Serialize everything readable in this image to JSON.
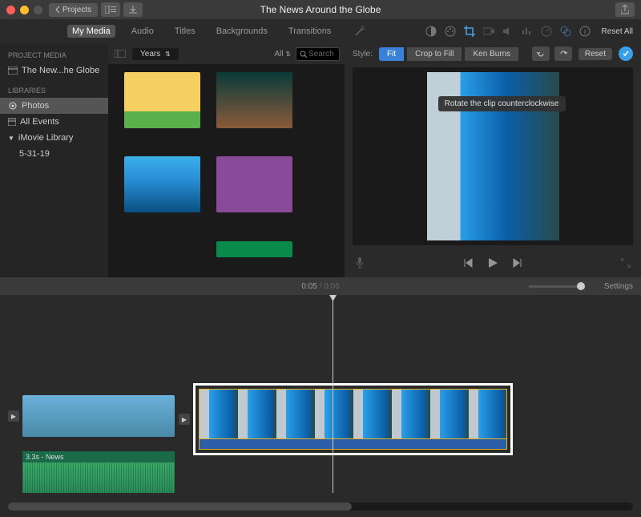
{
  "titlebar": {
    "projects_label": "Projects",
    "title": "The News Around the Globe"
  },
  "tabs": {
    "my_media": "My Media",
    "audio": "Audio",
    "titles": "Titles",
    "backgrounds": "Backgrounds",
    "transitions": "Transitions"
  },
  "sidebar": {
    "project_media_hdr": "PROJECT MEDIA",
    "project_item": "The New...he Globe",
    "libraries_hdr": "LIBRARIES",
    "photos": "Photos",
    "all_events": "All Events",
    "imovie_lib": "iMovie Library",
    "date": "5-31-19"
  },
  "browser": {
    "years": "Years",
    "all": "All",
    "search_placeholder": "Search"
  },
  "viewer": {
    "reset_all": "Reset All",
    "style": "Style:",
    "fit": "Fit",
    "crop_to_fill": "Crop to Fill",
    "ken_burns": "Ken Burns",
    "reset": "Reset",
    "tooltip": "Rotate the clip counterclockwise"
  },
  "timeline": {
    "time_current": "0:05",
    "time_total": "0:06",
    "settings": "Settings",
    "audio_label": "3.3s - News"
  }
}
